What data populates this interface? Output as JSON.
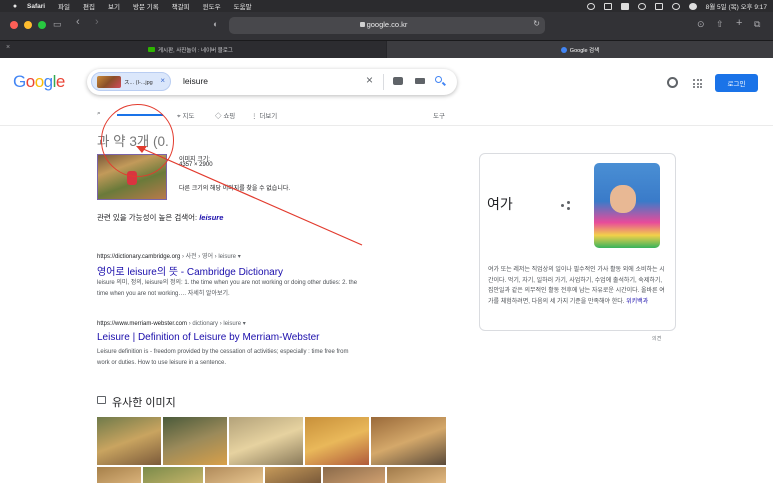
{
  "menubar": {
    "app": "Safari",
    "items": [
      "파일",
      "편집",
      "보기",
      "방문 기록",
      "책갈피",
      "윈도우",
      "도움말"
    ],
    "clock": "8월 5일 (목) 오후 9:17"
  },
  "browser": {
    "url": "google.co.kr",
    "tabs": [
      {
        "label": "게시판, 사진놀이 : 네이버 블로그",
        "favicon_color": "#2db400"
      },
      {
        "label": "Google 검색",
        "favicon_color": "#4285f4"
      }
    ]
  },
  "google": {
    "logo": [
      "G",
      "o",
      "o",
      "g",
      "l",
      "e"
    ],
    "logo_colors": [
      "#4285f4",
      "#ea4335",
      "#fbbc05",
      "#4285f4",
      "#34a853",
      "#ea4335"
    ],
    "chip_label": "ス... (I-...jpg",
    "query": "leisure",
    "login_label": "로그인",
    "nav": {
      "all": "",
      "map": "지도",
      "shopping": "쇼핑",
      "more": "더보기",
      "tools": "도구"
    }
  },
  "results": {
    "count": "과 약 3개 (0.",
    "image_size_label": "이미지 크기:",
    "image_size": "4357 × 2900",
    "no_other_sizes": "다른 크기의 해당 이미지를 찾을 수 없습니다.",
    "related_prefix": "관련 있을 가능성이 높은 검색어:",
    "related_term": "leisure",
    "items": [
      {
        "url": "https://dictionary.cambridge.org",
        "crumbs": "› 사전 › 영어 › leisure",
        "title": "영어로 leisure의 뜻 - Cambridge Dictionary",
        "snippet_line1": "leisure 의미, 정의, leisure의 정의: 1. the time when you are not working or doing other duties: 2. the",
        "snippet_line2": "time when you are not working…. 자세히 알아보기."
      },
      {
        "url": "https://www.merriam-webster.com",
        "crumbs": "› dictionary › leisure",
        "title": "Leisure | Definition of Leisure by Merriam-Webster",
        "snippet_line1": "Leisure definition is - freedom provided by the cessation of activities; especially : time free from",
        "snippet_line2": "work or duties. How to use leisure in a sentence."
      }
    ],
    "similar_title": "유사한 이미지"
  },
  "knowledge_panel": {
    "title": "여가",
    "description": "여가 또는 레저는 직업상의 일이나 필수적인 가사 활동 외에 소비하는 시간이다. 먹기, 자기, 일하러 가기, 사업하기, 수업에 출석하기, 숙제하기, 집안일과 같은 의무적인 활동 전후에 남는 자유로운 시간이다. 올바른 여가를 체험하려면, 다음의 세 가지 기준을 만족해야 한다.",
    "source_link": "위키백과",
    "feedback": "의견"
  }
}
